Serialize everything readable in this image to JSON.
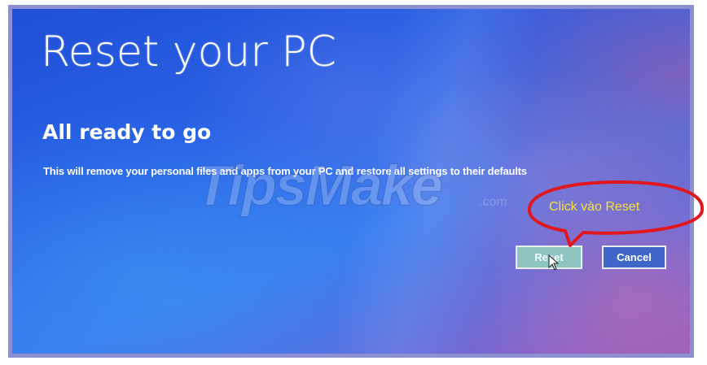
{
  "window": {
    "title": "Reset your PC"
  },
  "main": {
    "heading": "All ready to go",
    "description": "This will remove your personal files and apps from your PC and restore all settings to their defaults"
  },
  "buttons": {
    "reset_label": "Reset",
    "cancel_label": "Cancel"
  },
  "annotation": {
    "callout_text": "Click vào Reset",
    "callout_color": "#e0181e",
    "callout_text_color": "#f2e23a"
  },
  "watermark": {
    "brand": "TipsMake",
    "suffix": ".com"
  },
  "colors": {
    "frame_border": "#8c8fd0",
    "background_blue": "#2a62e6",
    "reset_button_bg": "#8ec5c0",
    "cancel_button_bg": "#3f66c8"
  },
  "icons": {
    "cursor": "mouse-pointer-icon"
  }
}
